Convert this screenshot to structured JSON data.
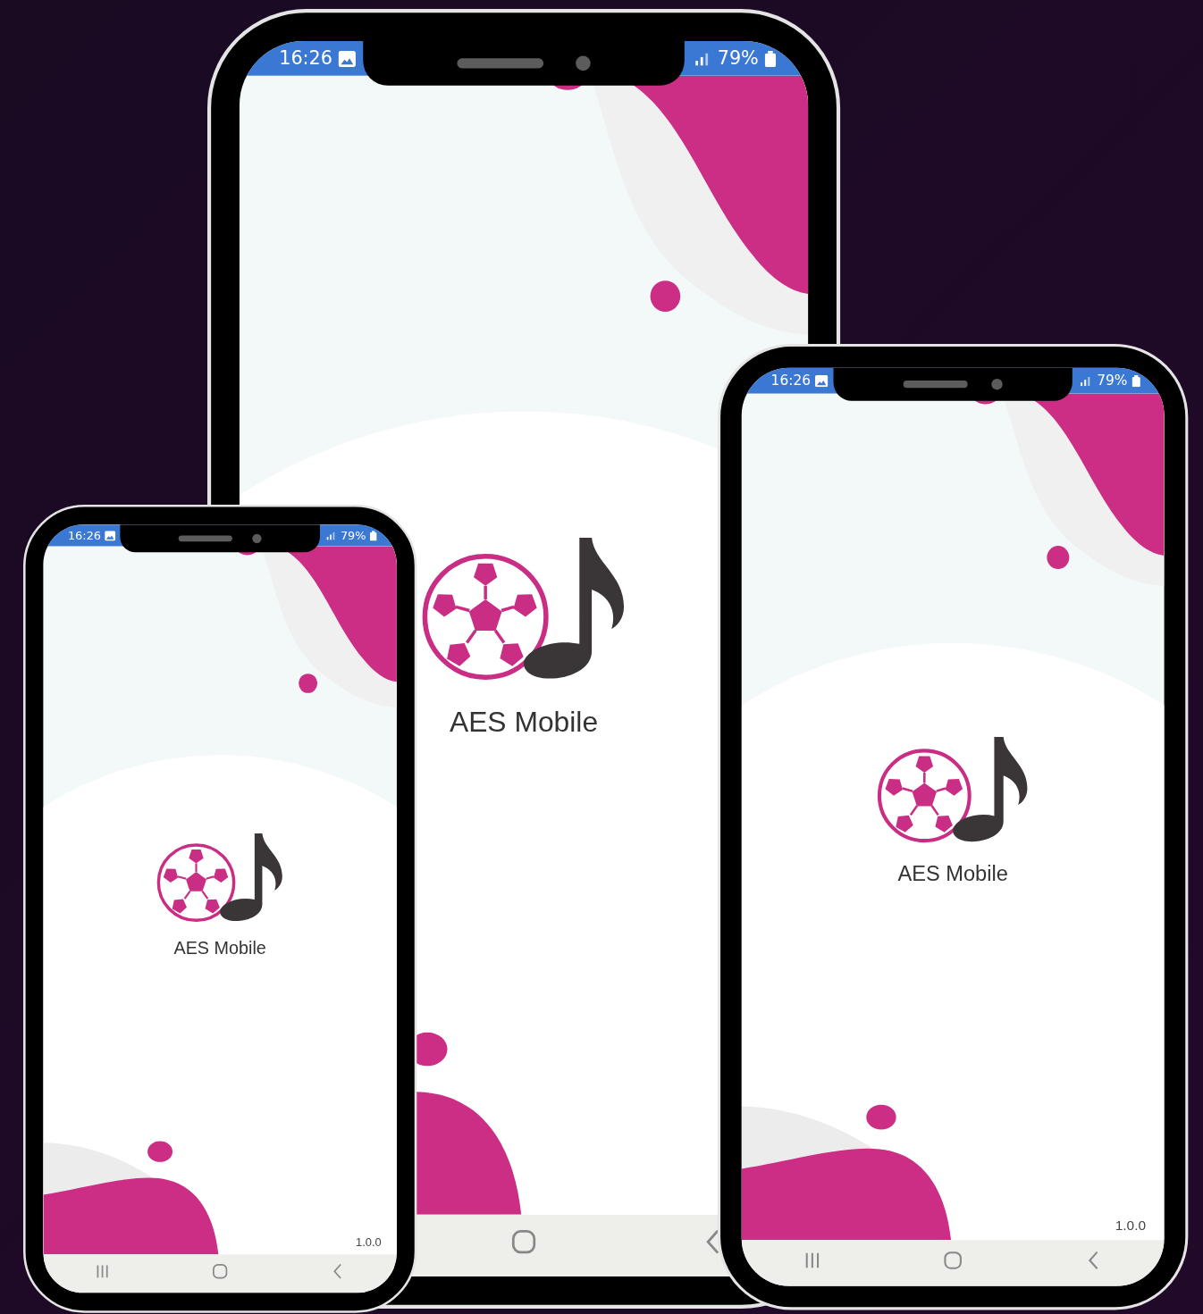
{
  "phones": [
    {
      "kind": "back",
      "status_bar": {
        "time": "16:26",
        "battery": "79%"
      },
      "app_name": "AES Mobile",
      "nav_buttons": [
        {
          "kind": "home"
        },
        {
          "kind": "back"
        }
      ]
    },
    {
      "kind": "left",
      "status_bar": {
        "time": "16:26",
        "battery": "79%"
      },
      "app_name": "AES Mobile",
      "version": "1.0.0",
      "nav_buttons": [
        {
          "kind": "recents"
        },
        {
          "kind": "home"
        },
        {
          "kind": "back"
        }
      ]
    },
    {
      "kind": "right",
      "status_bar": {
        "time": "16:26",
        "battery": "79%"
      },
      "app_name": "AES Mobile",
      "version": "1.0.0",
      "nav_buttons": [
        {
          "kind": "recents"
        },
        {
          "kind": "home"
        },
        {
          "kind": "back"
        }
      ]
    }
  ]
}
